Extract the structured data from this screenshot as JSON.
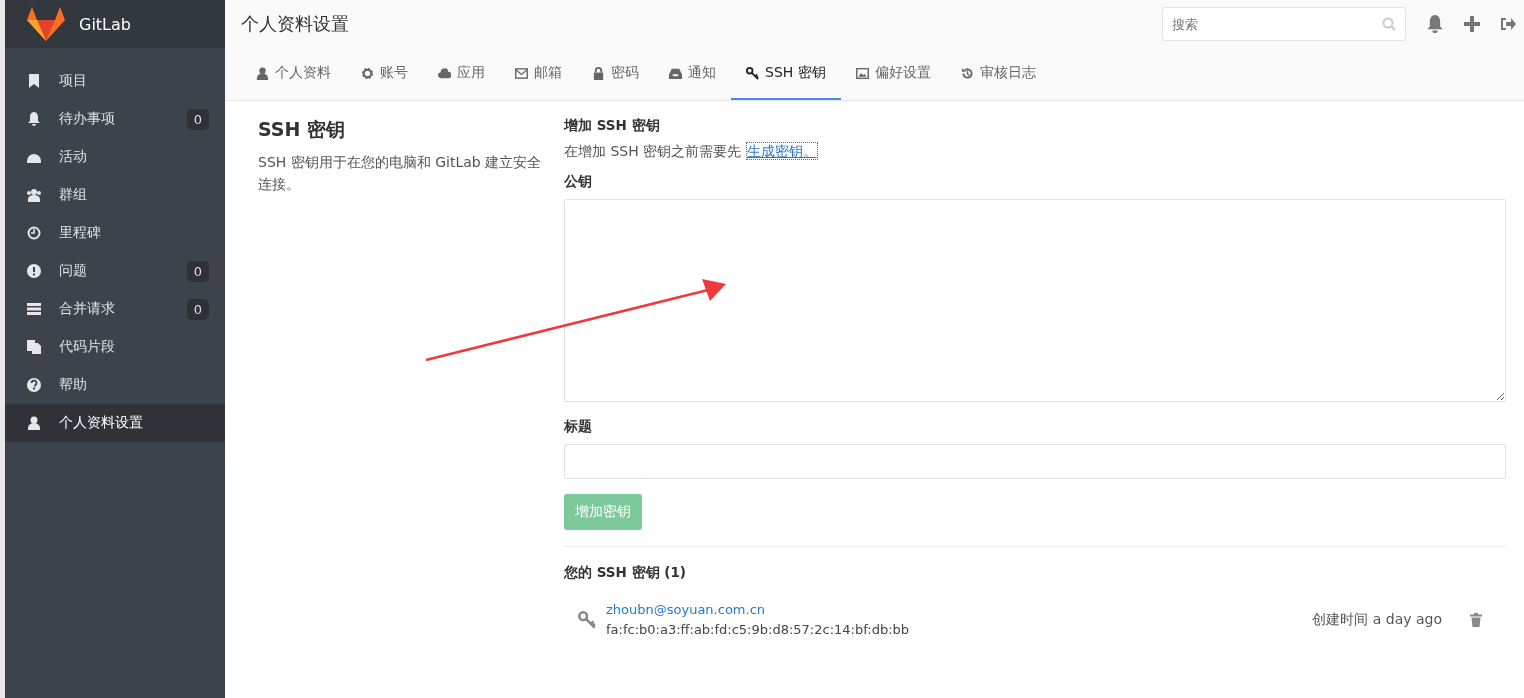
{
  "brand": {
    "name": "GitLab"
  },
  "sidebar": {
    "items": [
      {
        "label": "项目",
        "selected": false
      },
      {
        "label": "待办事项",
        "badge": "0",
        "selected": false
      },
      {
        "label": "活动",
        "selected": false
      },
      {
        "label": "群组",
        "selected": false
      },
      {
        "label": "里程碑",
        "selected": false
      },
      {
        "label": "问题",
        "badge": "0",
        "selected": false
      },
      {
        "label": "合并请求",
        "badge": "0",
        "selected": false
      },
      {
        "label": "代码片段",
        "selected": false
      },
      {
        "label": "帮助",
        "selected": false
      },
      {
        "label": "个人资料设置",
        "selected": true
      }
    ]
  },
  "header": {
    "title": "个人资料设置",
    "search": {
      "placeholder": "搜索"
    }
  },
  "tabs": [
    {
      "label": "个人资料",
      "selected": false
    },
    {
      "label": "账号",
      "selected": false
    },
    {
      "label": "应用",
      "selected": false
    },
    {
      "label": "邮箱",
      "selected": false
    },
    {
      "label": "密码",
      "selected": false
    },
    {
      "label": "通知",
      "selected": false
    },
    {
      "label": "SSH 密钥",
      "selected": true
    },
    {
      "label": "偏好设置",
      "selected": false
    },
    {
      "label": "审核日志",
      "selected": false
    }
  ],
  "intro": {
    "title": "SSH 密钥",
    "description": "SSH 密钥用于在您的电脑和 GitLab 建立安全连接。"
  },
  "form": {
    "heading": "增加 SSH 密钥",
    "hint": "在增加 SSH 密钥之前需要先",
    "hint_link": "生成密钥。",
    "key_label": "公钥",
    "title_label": "标题",
    "submit": "增加密钥",
    "submit_disabled": true
  },
  "keys": {
    "heading": "您的 SSH 密钥 (1)",
    "items": [
      {
        "name": "zhoubn@soyuan.com.cn",
        "fingerprint": "fa:fc:b0:a3:ff:ab:fd:c5:9b:d8:57:2c:14:bf:db:bb",
        "created": "创建时间 a day ago"
      }
    ]
  }
}
